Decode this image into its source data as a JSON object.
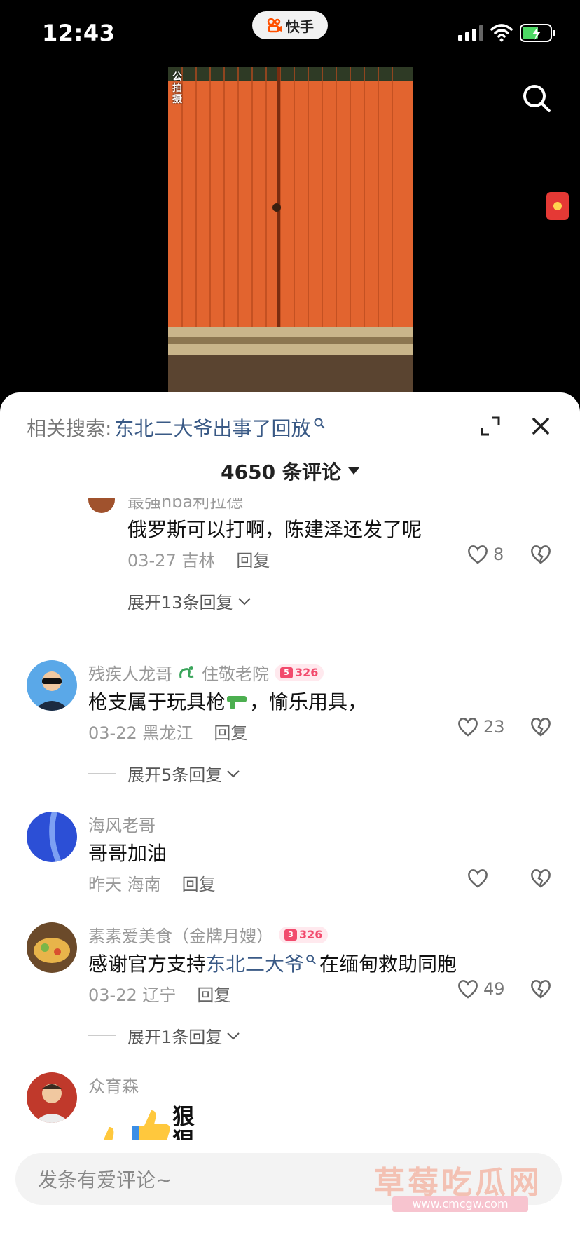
{
  "status_bar": {
    "time": "12:43",
    "app_badge": "快手"
  },
  "video": {
    "overlay_text": "公拍摄",
    "scene": "orange-metal-gate"
  },
  "sheet": {
    "related_label": "相关搜索:",
    "related_keyword": "东北二大爷出事了回放",
    "comment_count": "4650 条评论"
  },
  "comments": [
    {
      "username": "最强nba利拉德",
      "text": "俄罗斯可以打啊，陈建泽还发了呢",
      "date": "03-27",
      "location": "吉林",
      "reply_label": "回复",
      "likes": "8",
      "more_replies": "展开13条回复"
    },
    {
      "username": "残疾人龙哥",
      "username_tail": "住敬老院",
      "badge_level": "5",
      "badge_value": "326",
      "text_main": "枪支属于玩具枪",
      "text_tail": "，愉乐用具，",
      "date": "03-22",
      "location": "黑龙江",
      "reply_label": "回复",
      "likes": "23",
      "more_replies": "展开5条回复"
    },
    {
      "username": "海风老哥",
      "text": "哥哥加油",
      "date": "昨天",
      "location": "海南",
      "reply_label": "回复",
      "likes": ""
    },
    {
      "username": "素素爱美食（金牌月嫂）",
      "badge_level": "3",
      "badge_value": "326",
      "text_prefix": "感谢官方支持",
      "text_keyword": "东北二大爷",
      "text_suffix": "在缅甸救助同胞",
      "date": "03-22",
      "location": "辽宁",
      "reply_label": "回复",
      "likes": "49",
      "more_replies": "展开1条回复"
    },
    {
      "username": "众育森",
      "text": "狠狠"
    }
  ],
  "input": {
    "placeholder": "发条有爱评论~"
  },
  "watermark": {
    "text": "草莓吃瓜网",
    "url": "www.cmcgw.com"
  },
  "colors": {
    "keyword": "#3a5a86",
    "badge": "#f24b6d",
    "gate": "#e2642f"
  }
}
